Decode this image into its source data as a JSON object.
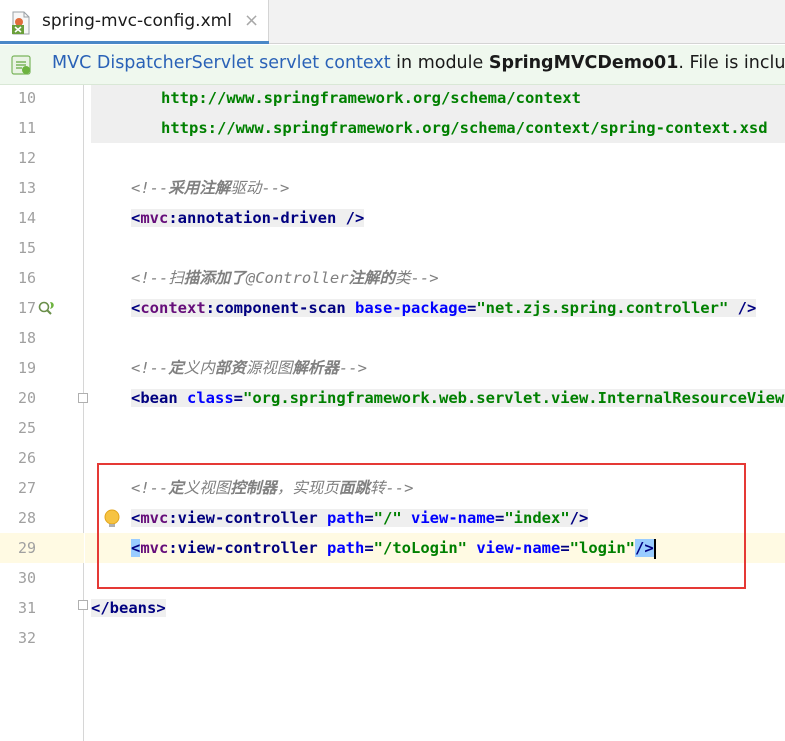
{
  "tab": {
    "title": "spring-mvc-config.xml",
    "close_glyph": "×",
    "icon": "xml-file-icon"
  },
  "banner": {
    "icon": "spring-mvc-icon",
    "link_text": "MVC DispatcherServlet servlet context",
    "text_in_module": " in module ",
    "module_name": "SpringMVCDemo01",
    "text_after": ". File is included"
  },
  "gutter": {
    "line_numbers": [
      "10",
      "11",
      "12",
      "13",
      "14",
      "15",
      "16",
      "17",
      "18",
      "19",
      "20",
      "25",
      "26",
      "27",
      "28",
      "29",
      "30",
      "31",
      "32"
    ]
  },
  "code": {
    "l10_url": "http://www.springframework.org/schema/context",
    "l11_url": "https://www.springframework.org/schema/context/spring-context.xsd",
    "l13_open": "<!--",
    "l13_cmt_b": "采用注解",
    "l13_cmt": "驱动",
    "l13_close": "-->",
    "l14_lt": "<",
    "l14_ns": "mvc",
    "l14_rest": ":annotation-driven",
    "l14_end": " />",
    "l16_open": "<!--",
    "l16_p1": "扫",
    "l16_p2b": "描添加了",
    "l16_p3": "@Controller",
    "l16_p4b": "注解的",
    "l16_p5": "类",
    "l16_close": "-->",
    "l17_lt": "<",
    "l17_ns": "context",
    "l17_tag": ":component-scan",
    "l17_attr": " base-package",
    "l17_eq": "=",
    "l17_val": "\"net.zjs.spring.controller\"",
    "l17_end": " />",
    "l19_open": "<!--",
    "l19_p1b": "定",
    "l19_p2": "义内",
    "l19_p3b": "部资",
    "l19_p4": "源视图",
    "l19_p5b": "解析器",
    "l19_close": "-->",
    "l20_lt": "<",
    "l20_tag": "bean",
    "l20_attr": " class",
    "l20_eq": "=",
    "l20_val": "\"org.springframework.web.servlet.view.InternalResourceViewResolver\"",
    "l27_open": "<!--",
    "l27_p1b": "定",
    "l27_p2": "义视图",
    "l27_p3b": "控制器",
    "l27_p4": "，实现页",
    "l27_p5b": "面跳",
    "l27_p6": "转",
    "l27_close": "-->",
    "l28_lt": "<",
    "l28_ns": "mvc",
    "l28_tag": ":view-controller",
    "l28_attr1": " path",
    "l28_eq1": "=",
    "l28_val1": "\"/\"",
    "l28_attr2": " view-name",
    "l28_eq2": "=",
    "l28_val2": "\"index\"",
    "l28_end": "/>",
    "l29_lt": "<",
    "l29_ns": "mvc",
    "l29_tag": ":view-controller",
    "l29_attr1": " path",
    "l29_eq1": "=",
    "l29_val1": "\"/toLogin\"",
    "l29_attr2": " view-name",
    "l29_eq2": "=",
    "l29_val2": "\"login\"",
    "l29_end": "/>",
    "l31": "</beans>"
  },
  "colors": {
    "tag": "#000080",
    "namespace": "#660e7a",
    "attribute": "#0000ff",
    "value": "#008000",
    "comment": "#808080",
    "annotation_box": "#e53935",
    "current_line": "#fffae3",
    "tab_underline": "#4a88c7"
  },
  "gutter_icons": [
    "spring-bean-icon",
    "intention-bulb-icon"
  ]
}
